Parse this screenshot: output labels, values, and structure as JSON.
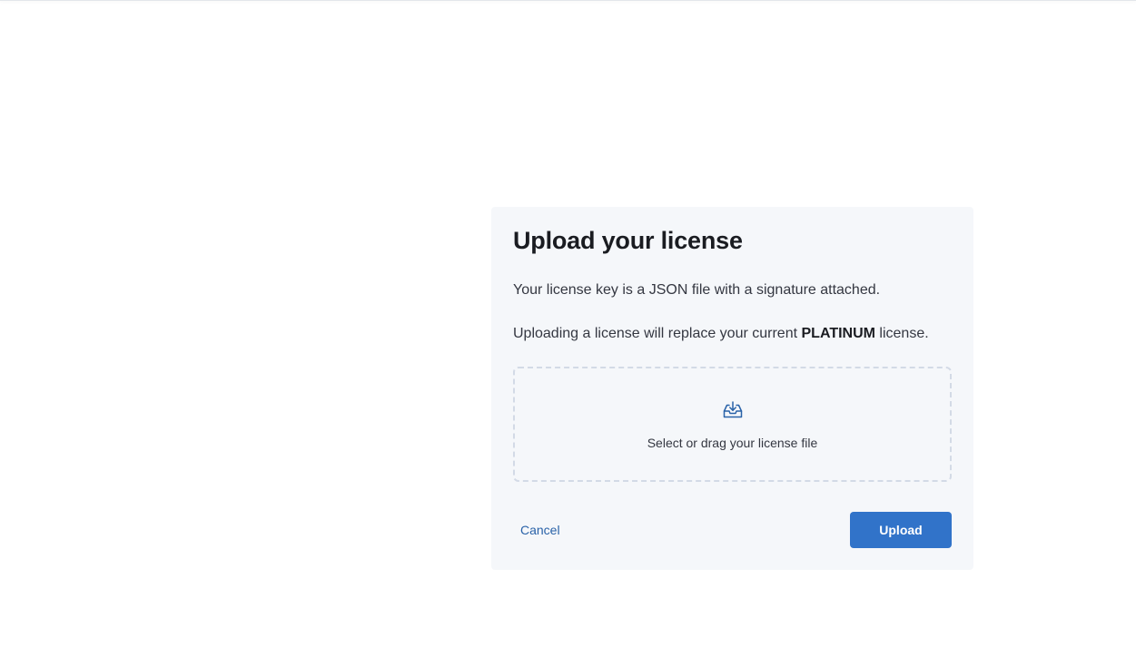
{
  "modal": {
    "title": "Upload your license",
    "description_line1": "Your license key is a JSON file with a signature attached.",
    "description_line2_prefix": "Uploading a license will replace your current ",
    "description_line2_bold": "PLATINUM",
    "description_line2_suffix": " license.",
    "dropzone": {
      "icon": "import-icon",
      "label": "Select or drag your license file"
    },
    "cancel_label": "Cancel",
    "upload_label": "Upload"
  },
  "colors": {
    "panel_bg": "#f5f7fa",
    "primary": "#3173c9",
    "link": "#2962a8",
    "title": "#1a1c21",
    "text": "#343741"
  }
}
